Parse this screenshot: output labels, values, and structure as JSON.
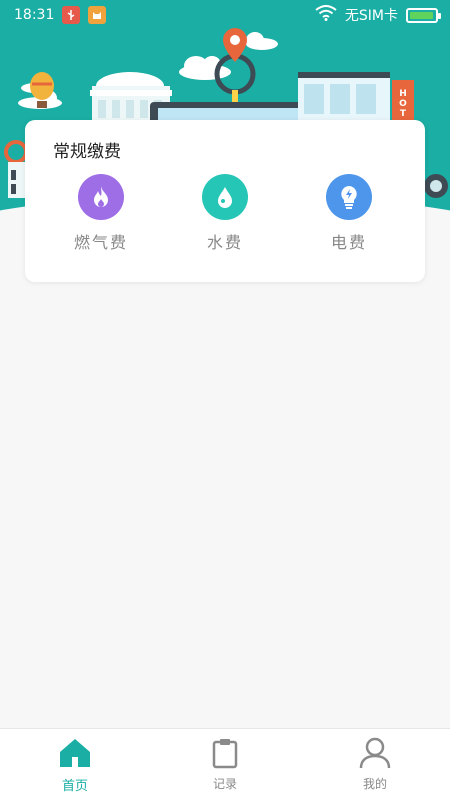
{
  "status_bar": {
    "time": "18:31",
    "carrier": "无SIM卡",
    "battery_level": 0.9
  },
  "card": {
    "title": "常规缴费",
    "services": [
      {
        "label": "燃气费",
        "icon": "flame-icon",
        "color": "#9d6ee6"
      },
      {
        "label": "水费",
        "icon": "water-drop-icon",
        "color": "#25c6b6"
      },
      {
        "label": "电费",
        "icon": "lightbulb-icon",
        "color": "#4d96ec"
      }
    ]
  },
  "tabbar": {
    "tabs": [
      {
        "label": "首页",
        "icon": "home-icon",
        "active": true
      },
      {
        "label": "记录",
        "icon": "clipboard-icon",
        "active": false
      },
      {
        "label": "我的",
        "icon": "user-icon",
        "active": false
      }
    ],
    "active_color": "#1aaea4"
  },
  "colors": {
    "brand": "#1aaea4",
    "banner_accent": "#e8663c"
  }
}
